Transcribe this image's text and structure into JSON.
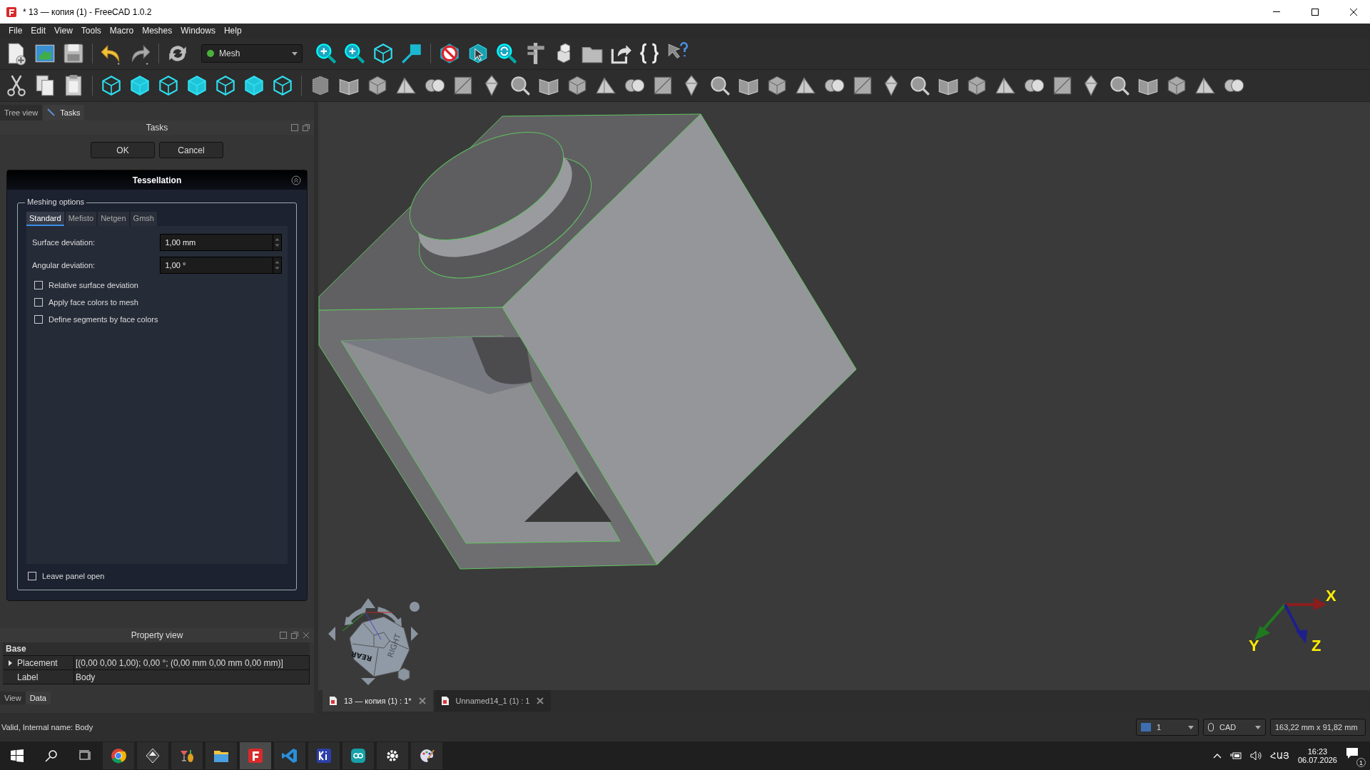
{
  "window": {
    "title": "* 13 — копия (1) - FreeCAD 1.0.2"
  },
  "menu": [
    "File",
    "Edit",
    "View",
    "Tools",
    "Macro",
    "Meshes",
    "Windows",
    "Help"
  ],
  "workbench": {
    "value": "Mesh"
  },
  "combo_view": {
    "tabs": [
      {
        "label": "Tree view",
        "selected": false
      },
      {
        "label": "Tasks",
        "selected": true
      }
    ],
    "title": "Tasks"
  },
  "buttons": [
    "OK",
    "Cancel"
  ],
  "task_panel": {
    "title": "Tessellation",
    "group": "Meshing options",
    "tabs": [
      {
        "label": "Standard",
        "selected": true
      },
      {
        "label": "Mefisto",
        "selected": false
      },
      {
        "label": "Netgen",
        "selected": false
      },
      {
        "label": "Gmsh",
        "selected": false
      }
    ],
    "fields": [
      {
        "label": "Surface deviation:",
        "value": "1,00 mm"
      },
      {
        "label": "Angular deviation:",
        "value": "1,00 °"
      }
    ],
    "options": [
      {
        "label": "Relative surface deviation",
        "checked": false
      },
      {
        "label": "Apply face colors to mesh",
        "checked": false
      },
      {
        "label": "Define segments by face colors",
        "checked": false
      }
    ],
    "leave_open": {
      "label": "Leave panel open",
      "checked": false
    }
  },
  "property_view": {
    "title": "Property view",
    "group": "Base",
    "rows": [
      {
        "name": "Placement",
        "value": "[(0,00 0,00 1,00); 0,00 °; (0,00 mm  0,00 mm  0,00 mm)]",
        "expanded": false
      },
      {
        "name": "Label",
        "value": "Body"
      }
    ],
    "tabs": [
      {
        "label": "View",
        "selected": false
      },
      {
        "label": "Data",
        "selected": true
      }
    ]
  },
  "navigation_cube": {
    "faces": [
      "RIGHT",
      "REAR"
    ]
  },
  "axes": [
    "X",
    "Y",
    "Z"
  ],
  "document_tabs": [
    {
      "label": "13 — копия (1) : 1*",
      "selected": true
    },
    {
      "label": "Unnamed14_1 (1) : 1",
      "selected": false
    }
  ],
  "status_bar": {
    "message": "Valid, Internal name: Body",
    "view_count": "1",
    "navigation": "CAD",
    "dimensions": "163,22 mm x 91,82 mm"
  },
  "taskbar": {
    "language": "ՀԱՅ",
    "time": "16:23",
    "date": "06.07.2026",
    "notifications": "1"
  }
}
